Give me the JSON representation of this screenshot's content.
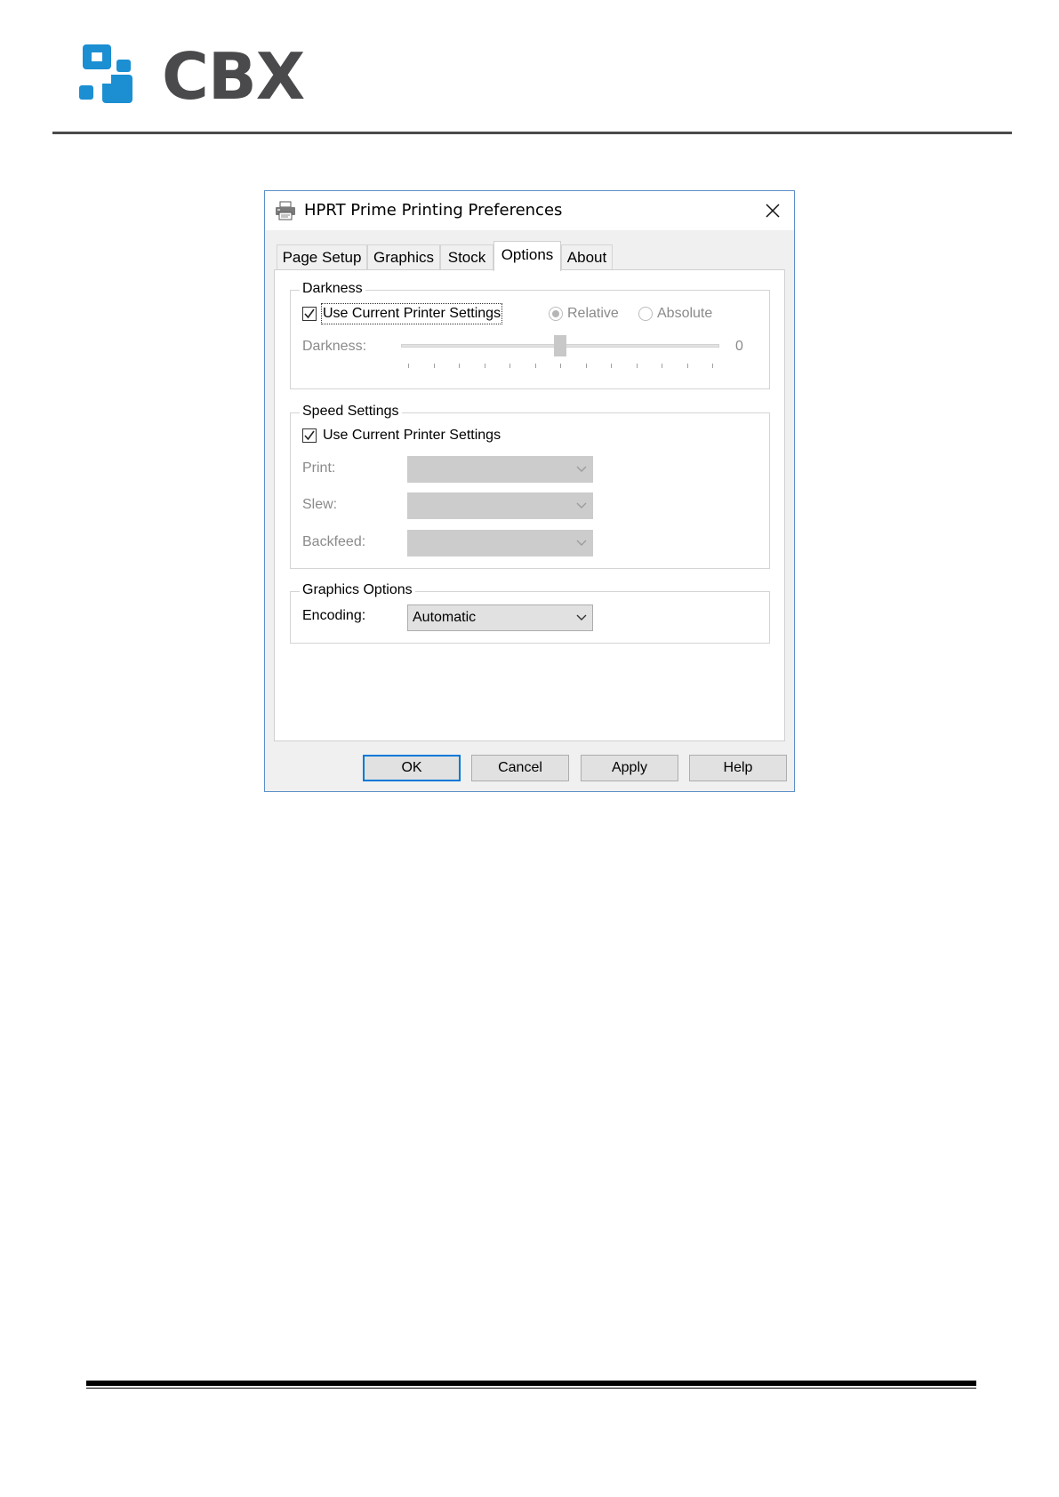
{
  "document": {
    "logo_text": "CBX",
    "logo_color": "#1b8fd2"
  },
  "dialog": {
    "title": "HPRT Prime Printing Preferences",
    "title_icon": "printer-icon",
    "close_icon": "close-icon",
    "tabs": [
      {
        "label": "Page Setup",
        "active": false
      },
      {
        "label": "Graphics",
        "active": false
      },
      {
        "label": "Stock",
        "active": false
      },
      {
        "label": "Options",
        "active": true
      },
      {
        "label": "About",
        "active": false
      }
    ],
    "darkness_group": {
      "label": "Darkness",
      "use_current_label": "Use Current Printer Settings",
      "use_current_checked": true,
      "relative_label": "Relative",
      "relative_selected": true,
      "absolute_label": "Absolute",
      "absolute_selected": false,
      "slider_label": "Darkness:",
      "slider_value": "0",
      "slider_position_fraction": 0.5,
      "enabled": false
    },
    "speed_group": {
      "label": "Speed Settings",
      "use_current_label": "Use Current Printer Settings",
      "use_current_checked": true,
      "print_label": "Print:",
      "print_value": "",
      "slew_label": "Slew:",
      "slew_value": "",
      "backfeed_label": "Backfeed:",
      "backfeed_value": "",
      "enabled": false
    },
    "graphics_group": {
      "label": "Graphics Options",
      "encoding_label": "Encoding:",
      "encoding_value": "Automatic"
    },
    "buttons": {
      "ok": "OK",
      "cancel": "Cancel",
      "apply": "Apply",
      "help": "Help"
    },
    "accent_color": "#0078d7"
  }
}
